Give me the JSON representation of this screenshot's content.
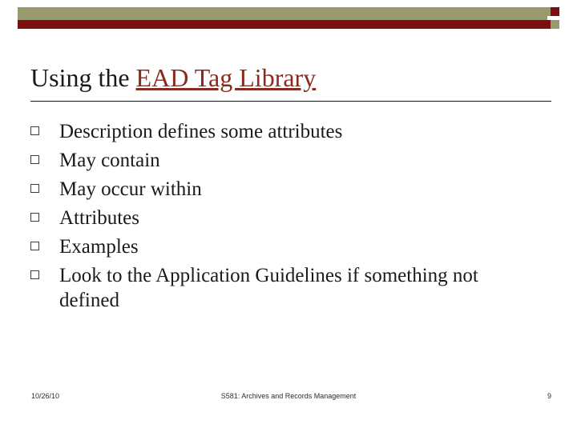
{
  "slide": {
    "title_prefix": "Using the ",
    "title_link": "EAD Tag Library",
    "bullets": [
      "Description defines some attributes",
      "May contain",
      "May occur within",
      "Attributes",
      "Examples",
      "Look to the Application Guidelines if something not defined"
    ]
  },
  "footer": {
    "date": "10/26/10",
    "course": "S581: Archives and Records Management",
    "page_number": "9"
  },
  "colors": {
    "banner_olive": "#9a9a6e",
    "banner_dark_red": "#7b0f10",
    "title_link": "#8d2a1f",
    "text": "#1a1a1a"
  }
}
